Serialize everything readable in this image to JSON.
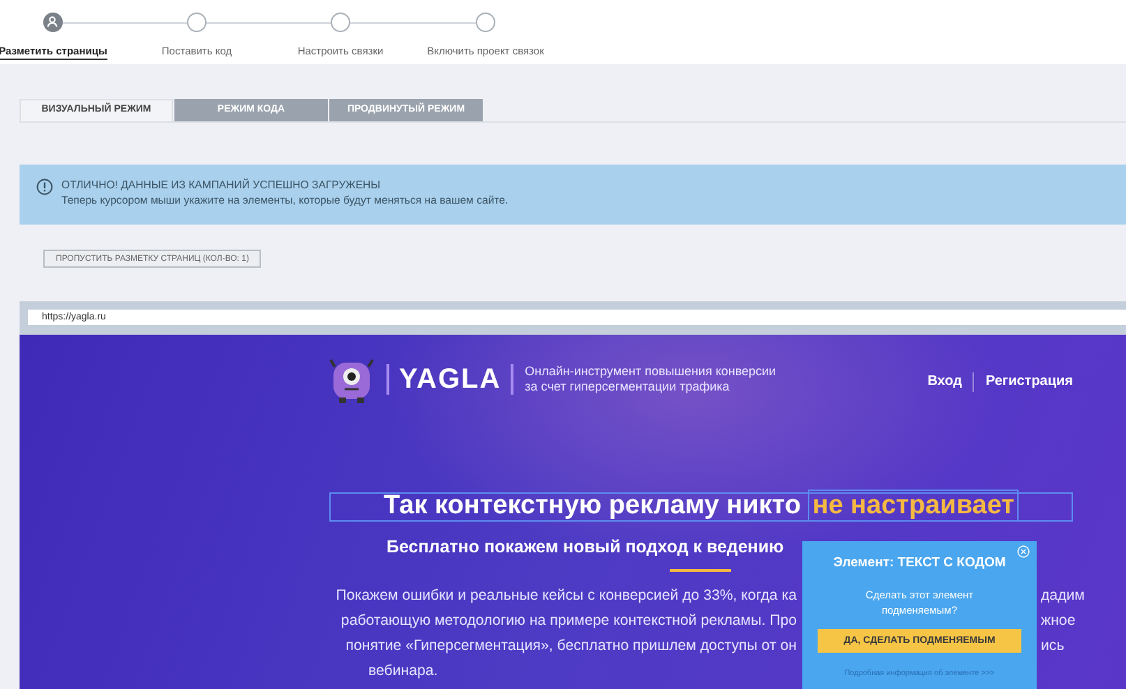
{
  "steps": [
    {
      "label": "Разметить страницы",
      "selected": true
    },
    {
      "label": "Поставить код",
      "selected": false
    },
    {
      "label": "Настроить связки",
      "selected": false
    },
    {
      "label": "Включить проект связок",
      "selected": false
    }
  ],
  "mode_tabs": [
    {
      "label": "ВИЗУАЛЬНЫЙ РЕЖИМ",
      "selected": true
    },
    {
      "label": "РЕЖИМ КОДА",
      "selected": false
    },
    {
      "label": "ПРОДВИНУТЫЙ РЕЖИМ",
      "selected": false
    }
  ],
  "alert": {
    "title": "ОТЛИЧНО! ДАННЫЕ ИЗ КАМПАНИЙ УСПЕШНО ЗАГРУЖЕНЫ",
    "text": "Теперь курсором мыши укажите на элементы, которые будут меняться на вашем сайте."
  },
  "skip_button": "ПРОПУСТИТЬ РАЗМЕТКУ СТРАНИЦ (КОЛ-ВО: 1)",
  "preview": {
    "url": "https://yagla.ru",
    "logo": "YAGLA",
    "tagline": [
      "Онлайн-инструмент повышения конверсии",
      "за счет гиперсегментации трафика"
    ],
    "nav": [
      "Вход",
      "Регистрация"
    ],
    "heading": "Так контекстную рекламу никто",
    "heading_highlight": "не настраивает",
    "subheading": "Бесплатно покажем новый подход к ведению",
    "paragraph_lines": [
      {
        "left": "Покажем ошибки и реальные кейсы с конверсией до 33%, когда ка",
        "right": "дадим"
      },
      {
        "left": "работающую методологию на примере контекстной рекламы. Про",
        "right": "жное"
      },
      {
        "left": "понятие «Гиперсегментация», бесплатно пришлем доступы от он",
        "right": "ись"
      },
      {
        "left": "вебинара."
      }
    ]
  },
  "popup": {
    "title": "Элемент: ТЕКСТ С КОДОМ",
    "question": "Сделать этот элемент подменяемым?",
    "button": "ДА, СДЕЛАТЬ ПОДМЕНЯЕМЫМ",
    "link": "Подробная информация об элементе >>>"
  }
}
